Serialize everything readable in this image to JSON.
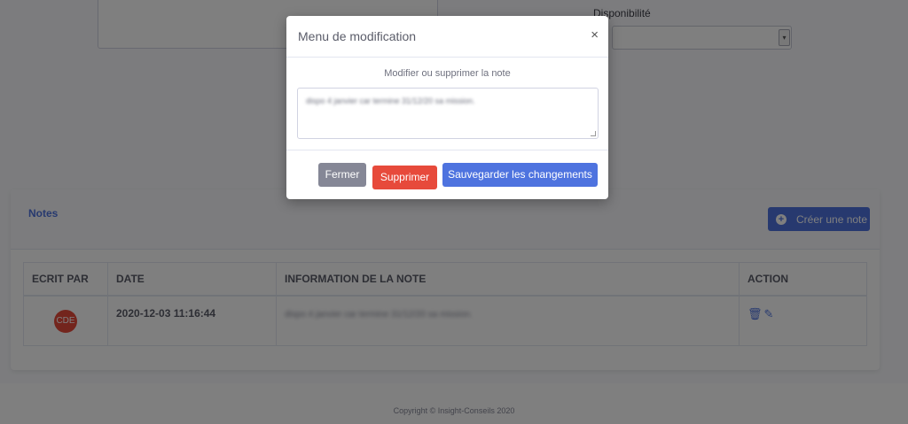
{
  "background": {
    "availability_label": "Disponibilité",
    "notes_title": "Notes",
    "create_note_label": "Créer une note",
    "table": {
      "headers": [
        "ECRIT PAR",
        "DATE",
        "INFORMATION DE LA NOTE",
        "ACTION"
      ],
      "rows": [
        {
          "author_initials": "CDE",
          "date": "2020-12-03 11:16:44",
          "info": "dispo 4 janvier car termine 31/12/20 sa mission."
        }
      ]
    },
    "footer": "Copyright © Insight-Conseils 2020"
  },
  "modal": {
    "title": "Menu de modification",
    "close_symbol": "×",
    "label": "Modifier ou supprimer la note",
    "textarea_value": "dispo 4 janvier car termine 31/12/20 sa mission.",
    "buttons": {
      "close": "Fermer",
      "delete": "Supprimer",
      "save": "Sauvegarder les changements"
    }
  },
  "colors": {
    "primary": "#4e73df",
    "danger": "#e74a3b",
    "secondary": "#858796"
  }
}
